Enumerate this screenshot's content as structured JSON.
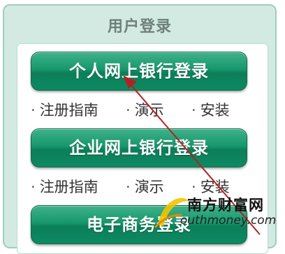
{
  "panel": {
    "title": "用户登录"
  },
  "buttons": [
    {
      "label": "个人网上银行登录"
    },
    {
      "label": "企业网上银行登录"
    },
    {
      "label": "电子商务登录"
    }
  ],
  "link_rows": [
    {
      "links": [
        "注册指南",
        "演示",
        "安装"
      ]
    },
    {
      "links": [
        "注册指南",
        "演示",
        "安装"
      ]
    }
  ],
  "watermark": {
    "title": "南方财富网",
    "url": "outhmoney.com"
  },
  "colors": {
    "button_green": "#17976d",
    "panel_bg": "#d3eae2",
    "arrow": "#b22222"
  },
  "icons": {
    "arrow": "annotation-arrow-icon",
    "logo": "watermark-logo-icon"
  }
}
